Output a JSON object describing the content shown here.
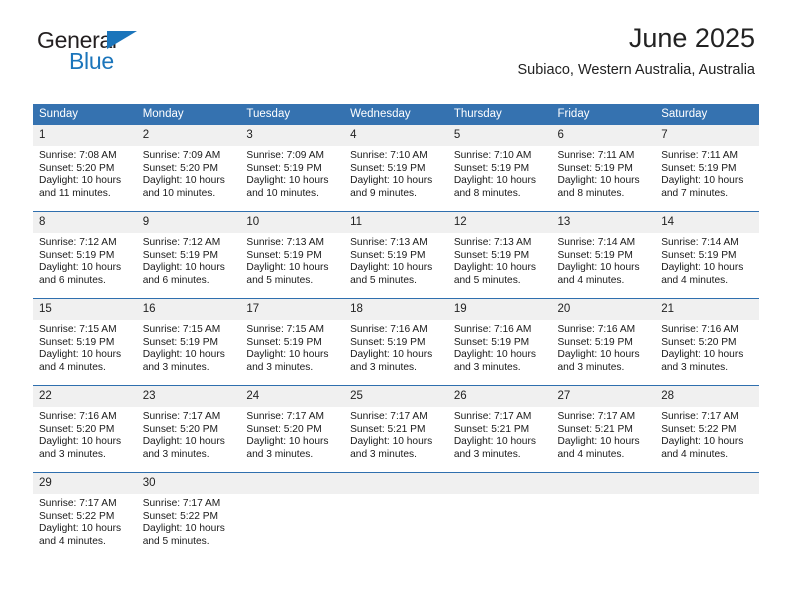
{
  "brand": {
    "word_one": "General",
    "word_two": "Blue",
    "triangle_color": "#1b75bb",
    "text_color": "#231f20"
  },
  "header": {
    "title": "June 2025",
    "subtitle": "Subiaco, Western Australia, Australia"
  },
  "theme": {
    "header_bg": "#3572b0",
    "header_text": "#ffffff",
    "daynum_bg": "#f0f0f0",
    "row_divider": "#2f6fae",
    "body_text": "#1a1a1a"
  },
  "weekday_headers": [
    "Sunday",
    "Monday",
    "Tuesday",
    "Wednesday",
    "Thursday",
    "Friday",
    "Saturday"
  ],
  "weeks": [
    [
      {
        "day": "1",
        "sunrise": "Sunrise: 7:08 AM",
        "sunset": "Sunset: 5:20 PM",
        "daylight_1": "Daylight: 10 hours",
        "daylight_2": "and 11 minutes."
      },
      {
        "day": "2",
        "sunrise": "Sunrise: 7:09 AM",
        "sunset": "Sunset: 5:20 PM",
        "daylight_1": "Daylight: 10 hours",
        "daylight_2": "and 10 minutes."
      },
      {
        "day": "3",
        "sunrise": "Sunrise: 7:09 AM",
        "sunset": "Sunset: 5:19 PM",
        "daylight_1": "Daylight: 10 hours",
        "daylight_2": "and 10 minutes."
      },
      {
        "day": "4",
        "sunrise": "Sunrise: 7:10 AM",
        "sunset": "Sunset: 5:19 PM",
        "daylight_1": "Daylight: 10 hours",
        "daylight_2": "and 9 minutes."
      },
      {
        "day": "5",
        "sunrise": "Sunrise: 7:10 AM",
        "sunset": "Sunset: 5:19 PM",
        "daylight_1": "Daylight: 10 hours",
        "daylight_2": "and 8 minutes."
      },
      {
        "day": "6",
        "sunrise": "Sunrise: 7:11 AM",
        "sunset": "Sunset: 5:19 PM",
        "daylight_1": "Daylight: 10 hours",
        "daylight_2": "and 8 minutes."
      },
      {
        "day": "7",
        "sunrise": "Sunrise: 7:11 AM",
        "sunset": "Sunset: 5:19 PM",
        "daylight_1": "Daylight: 10 hours",
        "daylight_2": "and 7 minutes."
      }
    ],
    [
      {
        "day": "8",
        "sunrise": "Sunrise: 7:12 AM",
        "sunset": "Sunset: 5:19 PM",
        "daylight_1": "Daylight: 10 hours",
        "daylight_2": "and 6 minutes."
      },
      {
        "day": "9",
        "sunrise": "Sunrise: 7:12 AM",
        "sunset": "Sunset: 5:19 PM",
        "daylight_1": "Daylight: 10 hours",
        "daylight_2": "and 6 minutes."
      },
      {
        "day": "10",
        "sunrise": "Sunrise: 7:13 AM",
        "sunset": "Sunset: 5:19 PM",
        "daylight_1": "Daylight: 10 hours",
        "daylight_2": "and 5 minutes."
      },
      {
        "day": "11",
        "sunrise": "Sunrise: 7:13 AM",
        "sunset": "Sunset: 5:19 PM",
        "daylight_1": "Daylight: 10 hours",
        "daylight_2": "and 5 minutes."
      },
      {
        "day": "12",
        "sunrise": "Sunrise: 7:13 AM",
        "sunset": "Sunset: 5:19 PM",
        "daylight_1": "Daylight: 10 hours",
        "daylight_2": "and 5 minutes."
      },
      {
        "day": "13",
        "sunrise": "Sunrise: 7:14 AM",
        "sunset": "Sunset: 5:19 PM",
        "daylight_1": "Daylight: 10 hours",
        "daylight_2": "and 4 minutes."
      },
      {
        "day": "14",
        "sunrise": "Sunrise: 7:14 AM",
        "sunset": "Sunset: 5:19 PM",
        "daylight_1": "Daylight: 10 hours",
        "daylight_2": "and 4 minutes."
      }
    ],
    [
      {
        "day": "15",
        "sunrise": "Sunrise: 7:15 AM",
        "sunset": "Sunset: 5:19 PM",
        "daylight_1": "Daylight: 10 hours",
        "daylight_2": "and 4 minutes."
      },
      {
        "day": "16",
        "sunrise": "Sunrise: 7:15 AM",
        "sunset": "Sunset: 5:19 PM",
        "daylight_1": "Daylight: 10 hours",
        "daylight_2": "and 3 minutes."
      },
      {
        "day": "17",
        "sunrise": "Sunrise: 7:15 AM",
        "sunset": "Sunset: 5:19 PM",
        "daylight_1": "Daylight: 10 hours",
        "daylight_2": "and 3 minutes."
      },
      {
        "day": "18",
        "sunrise": "Sunrise: 7:16 AM",
        "sunset": "Sunset: 5:19 PM",
        "daylight_1": "Daylight: 10 hours",
        "daylight_2": "and 3 minutes."
      },
      {
        "day": "19",
        "sunrise": "Sunrise: 7:16 AM",
        "sunset": "Sunset: 5:19 PM",
        "daylight_1": "Daylight: 10 hours",
        "daylight_2": "and 3 minutes."
      },
      {
        "day": "20",
        "sunrise": "Sunrise: 7:16 AM",
        "sunset": "Sunset: 5:19 PM",
        "daylight_1": "Daylight: 10 hours",
        "daylight_2": "and 3 minutes."
      },
      {
        "day": "21",
        "sunrise": "Sunrise: 7:16 AM",
        "sunset": "Sunset: 5:20 PM",
        "daylight_1": "Daylight: 10 hours",
        "daylight_2": "and 3 minutes."
      }
    ],
    [
      {
        "day": "22",
        "sunrise": "Sunrise: 7:16 AM",
        "sunset": "Sunset: 5:20 PM",
        "daylight_1": "Daylight: 10 hours",
        "daylight_2": "and 3 minutes."
      },
      {
        "day": "23",
        "sunrise": "Sunrise: 7:17 AM",
        "sunset": "Sunset: 5:20 PM",
        "daylight_1": "Daylight: 10 hours",
        "daylight_2": "and 3 minutes."
      },
      {
        "day": "24",
        "sunrise": "Sunrise: 7:17 AM",
        "sunset": "Sunset: 5:20 PM",
        "daylight_1": "Daylight: 10 hours",
        "daylight_2": "and 3 minutes."
      },
      {
        "day": "25",
        "sunrise": "Sunrise: 7:17 AM",
        "sunset": "Sunset: 5:21 PM",
        "daylight_1": "Daylight: 10 hours",
        "daylight_2": "and 3 minutes."
      },
      {
        "day": "26",
        "sunrise": "Sunrise: 7:17 AM",
        "sunset": "Sunset: 5:21 PM",
        "daylight_1": "Daylight: 10 hours",
        "daylight_2": "and 3 minutes."
      },
      {
        "day": "27",
        "sunrise": "Sunrise: 7:17 AM",
        "sunset": "Sunset: 5:21 PM",
        "daylight_1": "Daylight: 10 hours",
        "daylight_2": "and 4 minutes."
      },
      {
        "day": "28",
        "sunrise": "Sunrise: 7:17 AM",
        "sunset": "Sunset: 5:22 PM",
        "daylight_1": "Daylight: 10 hours",
        "daylight_2": "and 4 minutes."
      }
    ],
    [
      {
        "day": "29",
        "sunrise": "Sunrise: 7:17 AM",
        "sunset": "Sunset: 5:22 PM",
        "daylight_1": "Daylight: 10 hours",
        "daylight_2": "and 4 minutes."
      },
      {
        "day": "30",
        "sunrise": "Sunrise: 7:17 AM",
        "sunset": "Sunset: 5:22 PM",
        "daylight_1": "Daylight: 10 hours",
        "daylight_2": "and 5 minutes."
      },
      {
        "day": "",
        "sunrise": "",
        "sunset": "",
        "daylight_1": "",
        "daylight_2": ""
      },
      {
        "day": "",
        "sunrise": "",
        "sunset": "",
        "daylight_1": "",
        "daylight_2": ""
      },
      {
        "day": "",
        "sunrise": "",
        "sunset": "",
        "daylight_1": "",
        "daylight_2": ""
      },
      {
        "day": "",
        "sunrise": "",
        "sunset": "",
        "daylight_1": "",
        "daylight_2": ""
      },
      {
        "day": "",
        "sunrise": "",
        "sunset": "",
        "daylight_1": "",
        "daylight_2": ""
      }
    ]
  ]
}
